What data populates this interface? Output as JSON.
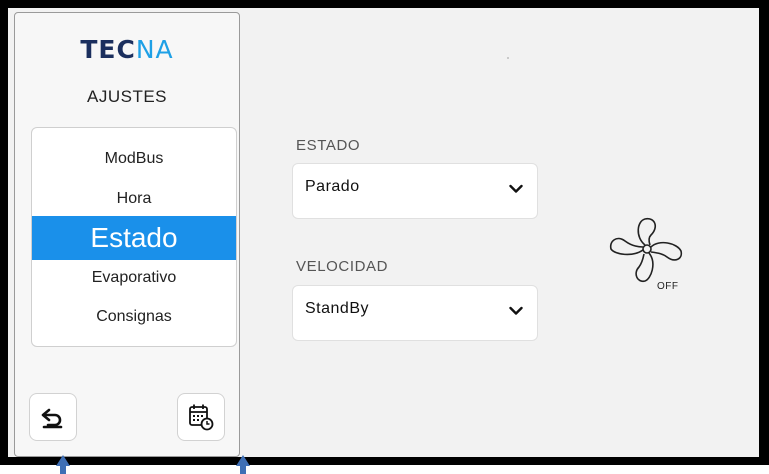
{
  "logo": {
    "part1": "TEC",
    "part2": "NA"
  },
  "sidebar": {
    "title": "AJUSTES",
    "items": [
      {
        "label": "ModBus",
        "active": false
      },
      {
        "label": "Hora",
        "active": false
      },
      {
        "label": "Estado",
        "active": true
      },
      {
        "label": "Evaporativo",
        "active": false
      },
      {
        "label": "Consignas",
        "active": false
      }
    ],
    "back_icon": "back-arrow-icon",
    "schedule_icon": "calendar-clock-icon"
  },
  "estado": {
    "label": "ESTADO",
    "value": "Parado"
  },
  "velocidad": {
    "label": "VELOCIDAD",
    "value": "StandBy"
  },
  "fan": {
    "icon": "fan-icon",
    "status": "OFF"
  },
  "colors": {
    "accent": "#1a90ea",
    "logo_dark": "#1b2f5e",
    "logo_light": "#1ea0e6",
    "pointer": "#3f6fb5"
  }
}
